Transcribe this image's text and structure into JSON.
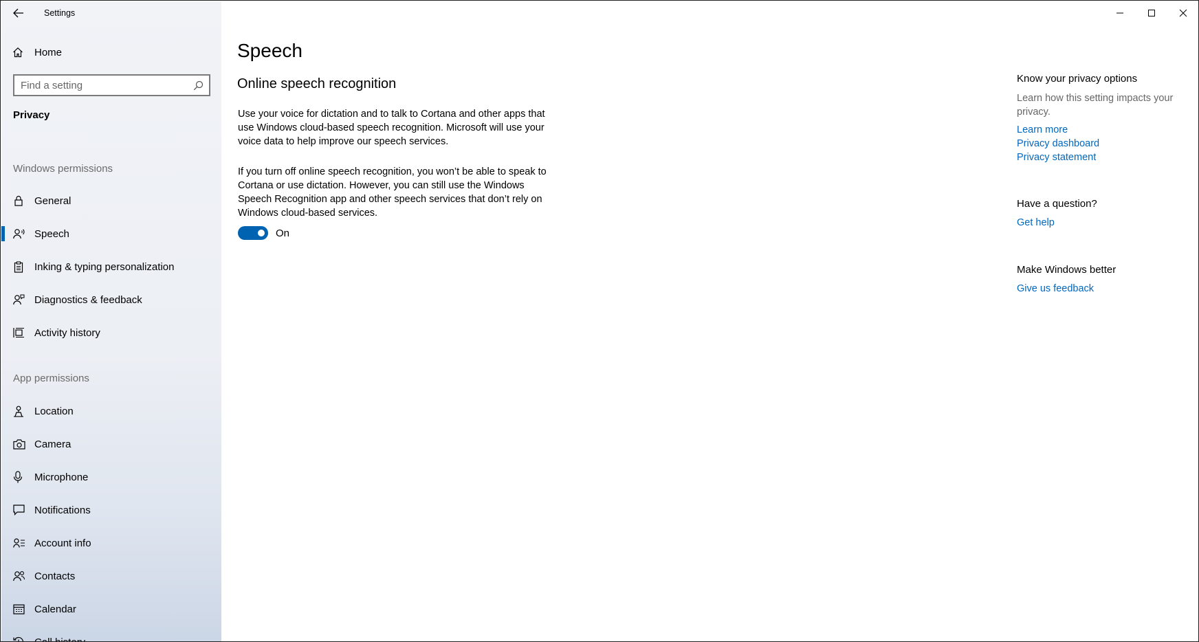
{
  "window": {
    "app_title": "Settings"
  },
  "sidebar": {
    "home_label": "Home",
    "search_placeholder": "Find a setting",
    "current_section": "Privacy",
    "windows_permissions_header": "Windows permissions",
    "windows_permissions": [
      {
        "label": "General",
        "icon": "lock-icon"
      },
      {
        "label": "Speech",
        "icon": "speech-icon",
        "selected": true
      },
      {
        "label": "Inking & typing personalization",
        "icon": "clipboard-icon"
      },
      {
        "label": "Diagnostics & feedback",
        "icon": "feedback-icon"
      },
      {
        "label": "Activity history",
        "icon": "activity-history-icon"
      }
    ],
    "app_permissions_header": "App permissions",
    "app_permissions": [
      {
        "label": "Location",
        "icon": "location-icon"
      },
      {
        "label": "Camera",
        "icon": "camera-icon"
      },
      {
        "label": "Microphone",
        "icon": "microphone-icon"
      },
      {
        "label": "Notifications",
        "icon": "notifications-icon"
      },
      {
        "label": "Account info",
        "icon": "account-info-icon"
      },
      {
        "label": "Contacts",
        "icon": "contacts-icon"
      },
      {
        "label": "Calendar",
        "icon": "calendar-icon"
      },
      {
        "label": "Call history",
        "icon": "call-history-icon"
      }
    ]
  },
  "main": {
    "page_title": "Speech",
    "section_title": "Online speech recognition",
    "paragraph_1": "Use your voice for dictation and to talk to Cortana and other apps that use Windows cloud-based speech recognition. Microsoft will use your voice data to help improve our speech services.",
    "paragraph_2": "If you turn off online speech recognition, you won’t be able to speak to Cortana or use dictation. However, you can still use the Windows Speech Recognition app and other speech services that don’t rely on Windows cloud-based services.",
    "toggle": {
      "state": true,
      "label": "On"
    }
  },
  "right_panel": {
    "privacy_header": "Know your privacy options",
    "privacy_text": "Learn how this setting impacts your privacy.",
    "privacy_links": [
      "Learn more",
      "Privacy dashboard",
      "Privacy statement"
    ],
    "question_header": "Have a question?",
    "question_link": "Get help",
    "feedback_header": "Make Windows better",
    "feedback_link": "Give us feedback"
  },
  "colors": {
    "accent": "#0063b1",
    "link": "#0067c0"
  }
}
